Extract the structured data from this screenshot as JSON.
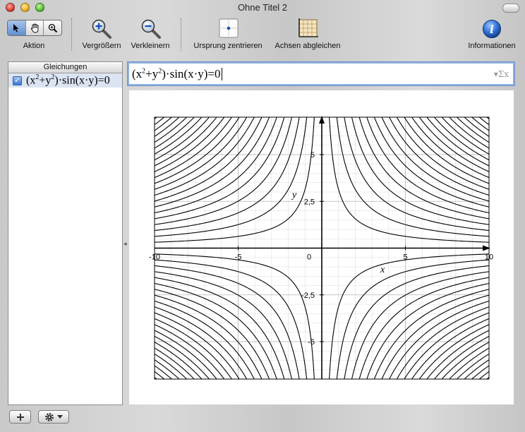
{
  "window": {
    "title": "Ohne Titel 2"
  },
  "toolbar": {
    "action_label": "Aktion",
    "zoom_in_label": "Vergrößern",
    "zoom_out_label": "Verkleinern",
    "center_origin_label": "Ursprung zentrieren",
    "equalize_axes_label": "Achsen abgleichen",
    "info_label": "Informationen",
    "tool_icons": [
      "arrow-pointer-icon",
      "hand-icon",
      "magnifier-icon"
    ],
    "active_tool": "arrow-pointer-icon"
  },
  "sidebar": {
    "header": "Gleichungen",
    "items": [
      {
        "checked": true,
        "equation": "(x²+y²)·sin(x·y)=0"
      }
    ]
  },
  "equation_editor": {
    "value": "(x²+y²)·sin(x·y)=0",
    "sigma_symbol": "▾Σx"
  },
  "graph": {
    "x_ticks": [
      "-10",
      "-5",
      "0",
      "5",
      "10"
    ],
    "y_ticks": [
      "5",
      "2,5",
      "-2,5",
      "-5"
    ],
    "x_axis_name": "x",
    "y_axis_name": "y",
    "xlim": [
      -10,
      10
    ],
    "ylim": [
      -7,
      7
    ],
    "axis_color": "#000000",
    "curve_color": "#000000",
    "grid_color": "#dddddd",
    "curve_constants": [
      3.1416,
      6.2832,
      9.4248,
      12.5664,
      15.708,
      18.8496,
      21.9911,
      25.1327,
      28.2743,
      31.4159,
      34.5575,
      37.6991,
      40.8407,
      43.9823,
      47.1239,
      50.2655,
      53.4071,
      56.5487,
      59.6903,
      62.8319,
      65.9734,
      69.115
    ]
  }
}
